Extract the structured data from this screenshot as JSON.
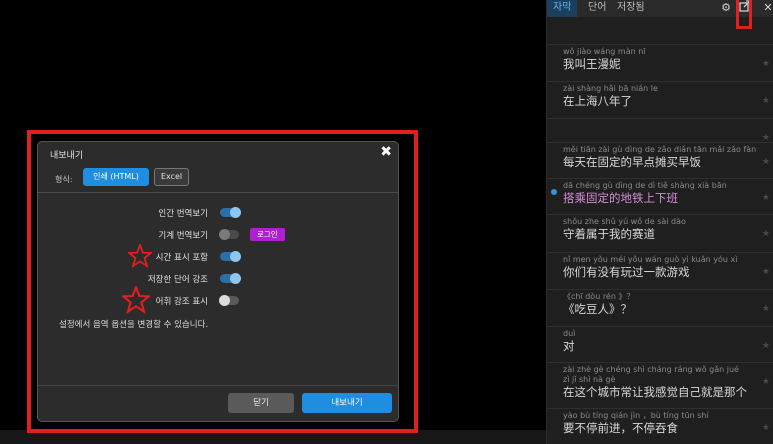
{
  "sidebar": {
    "tabs": [
      {
        "label": "자막",
        "active": true
      },
      {
        "label": "단어",
        "active": false
      },
      {
        "label": "저장됨",
        "active": false
      }
    ],
    "subtitles": [
      {
        "pinyin": "wǒ jiào wáng màn nī",
        "hanzi": "我叫王漫妮",
        "current": false
      },
      {
        "pinyin": "zài shàng hǎi bā nián le",
        "hanzi": "在上海八年了",
        "current": false
      },
      {
        "pinyin": "",
        "hanzi": "",
        "current": false
      },
      {
        "pinyin": "měi tiān zài gù dìng de zǎo diǎn tān mǎi zǎo fàn",
        "hanzi": "每天在固定的早点摊买早饭",
        "current": false
      },
      {
        "pinyin": "dā chéng gù dìng de dì tiě shàng xià bān",
        "hanzi": "搭乘固定的地铁上下班",
        "current": true
      },
      {
        "pinyin": "shǒu zhe shǔ yú wǒ de sài dào",
        "hanzi": "守着属于我的赛道",
        "current": false
      },
      {
        "pinyin": "nǐ men yǒu méi yǒu wán guò yì kuǎn yóu xì",
        "hanzi": "你们有没有玩过一款游戏",
        "current": false
      },
      {
        "pinyin": "《chī dòu rén 》？",
        "hanzi": "《吃豆人》？",
        "current": false
      },
      {
        "pinyin": "duì",
        "hanzi": "对",
        "current": false
      },
      {
        "pinyin": "zài zhè gè chéng shì cháng ráng wǒ gǎn jué zì jǐ shì nà gè",
        "hanzi": "在这个城市常让我感觉自己就是那个",
        "current": false
      },
      {
        "pinyin": "yào bù tíng qián jìn ，bù tíng tūn shí",
        "hanzi": "要不停前进，不停吞食",
        "current": false
      }
    ]
  },
  "dialog": {
    "title": "내보내기",
    "format_label": "형식:",
    "format_html": "인쇄 (HTML)",
    "format_excel": "Excel",
    "options": [
      {
        "label": "인간 번역보기",
        "state": "on"
      },
      {
        "label": "기계 번역보기",
        "state": "disabled",
        "badge": "로그인"
      },
      {
        "label": "시간 표시 포함",
        "state": "on"
      },
      {
        "label": "저장한 단어 강조",
        "state": "on"
      },
      {
        "label": "어휘 강조 표시",
        "state": "off"
      }
    ],
    "note": "설정에서 음역 옵션을 변경할 수 있습니다.",
    "close_button": "닫기",
    "export_button": "내보내기"
  },
  "colors": {
    "accent": "#1f8de0",
    "highlight": "#e01f1f",
    "badge": "#b01fd1"
  }
}
